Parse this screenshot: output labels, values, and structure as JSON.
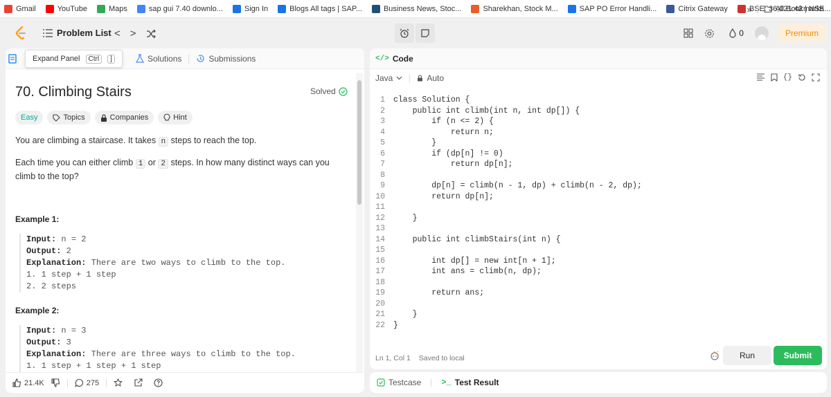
{
  "bookmarks": [
    {
      "label": "Gmail",
      "icon": "gmail-icon",
      "color": "#ea4335"
    },
    {
      "label": "YouTube",
      "icon": "youtube-icon",
      "color": "#ff0000"
    },
    {
      "label": "Maps",
      "icon": "maps-icon",
      "color": "#34a853"
    },
    {
      "label": "sap gui 7.40 downlo...",
      "icon": "google-icon",
      "color": "#4285f4"
    },
    {
      "label": "Sign In",
      "icon": "globe-icon",
      "color": "#1a73e8"
    },
    {
      "label": "Blogs All tags | SAP...",
      "icon": "sap-icon",
      "color": "#1a73e8"
    },
    {
      "label": "Business News, Stoc...",
      "icon": "news-icon",
      "color": "#1f4e79"
    },
    {
      "label": "Sharekhan, Stock M...",
      "icon": "sharekhan-icon",
      "color": "#e85d2a"
    },
    {
      "label": "SAP PO Error Handli...",
      "icon": "sap-icon",
      "color": "#1a73e8"
    },
    {
      "label": "Citrix Gateway",
      "icon": "citrix-icon",
      "color": "#3b5998"
    },
    {
      "label": "BSE: 36,021.42 | NSE...",
      "icon": "bse-icon",
      "color": "#d0312d"
    }
  ],
  "bookmarks_overflow": "»",
  "all_bookmarks": "All Bookmarks",
  "nav": {
    "problem_list": "Problem List",
    "prev": "<",
    "next": ">",
    "streak_count": "0",
    "premium": "Premium"
  },
  "left": {
    "tooltip_label": "Expand Panel",
    "tooltip_key1": "Ctrl",
    "tooltip_key2": "]",
    "tab_solutions": "Solutions",
    "tab_submissions": "Submissions",
    "title": "70. Climbing Stairs",
    "solved": "Solved",
    "tag_easy": "Easy",
    "tag_topics": "Topics",
    "tag_companies": "Companies",
    "tag_hint": "Hint",
    "desc1_a": "You are climbing a staircase. It takes ",
    "desc1_code": "n",
    "desc1_b": " steps to reach the top.",
    "desc2_a": "Each time you can either climb ",
    "desc2_code1": "1",
    "desc2_or": " or ",
    "desc2_code2": "2",
    "desc2_b": " steps. In how many distinct ways can you climb to the top?",
    "ex1_title": "Example 1:",
    "ex1_input_k": "Input:",
    "ex1_input_v": " n = 2",
    "ex1_output_k": "Output:",
    "ex1_output_v": " 2",
    "ex1_expl_k": "Explanation:",
    "ex1_expl_v": " There are two ways to climb to the top.",
    "ex1_line1": "1. 1 step + 1 step",
    "ex1_line2": "2. 2 steps",
    "ex2_title": "Example 2:",
    "ex2_input_k": "Input:",
    "ex2_input_v": " n = 3",
    "ex2_output_k": "Output:",
    "ex2_output_v": " 3",
    "ex2_expl_k": "Explanation:",
    "ex2_expl_v": " There are three ways to climb to the top.",
    "ex2_line1": "1. 1 step + 1 step + 1 step",
    "likes": "21.4K",
    "comments": "275"
  },
  "code": {
    "header": "Code",
    "language": "Java",
    "mode": "Auto",
    "lines": [
      "class Solution {",
      "    public int climb(int n, int dp[]) {",
      "        if (n <= 2) {",
      "            return n;",
      "        }",
      "        if (dp[n] != 0)",
      "            return dp[n];",
      "",
      "        dp[n] = climb(n - 1, dp) + climb(n - 2, dp);",
      "        return dp[n];",
      "",
      "    }",
      "",
      "    public int climbStairs(int n) {",
      "",
      "        int dp[] = new int[n + 1];",
      "        int ans = climb(n, dp);",
      "",
      "        return ans;",
      "",
      "    }",
      "}"
    ],
    "cursor": "Ln 1, Col 1",
    "saved": "Saved to local",
    "run": "Run",
    "submit": "Submit"
  },
  "bottom": {
    "testcase": "Testcase",
    "test_result": "Test Result"
  },
  "colors": {
    "accent_green": "#2cbb5d",
    "easy": "#00af9b",
    "premium": "#f09000"
  }
}
